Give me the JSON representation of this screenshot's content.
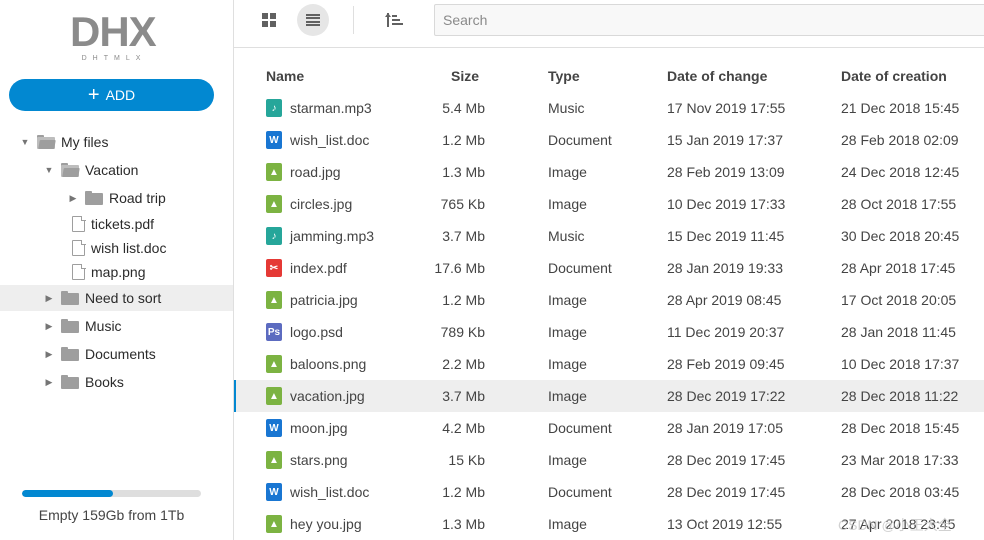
{
  "logo": {
    "text": "DHX",
    "subtext": "DHTMLX"
  },
  "add_button": {
    "label": "ADD",
    "icon": "plus-icon"
  },
  "tree": [
    {
      "label": "My files",
      "level": 0,
      "kind": "folder-open",
      "arrow": "down",
      "selected": false
    },
    {
      "label": "Vacation",
      "level": 1,
      "kind": "folder-open",
      "arrow": "down",
      "selected": false
    },
    {
      "label": "Road trip",
      "level": 2,
      "kind": "folder",
      "arrow": "right",
      "selected": false
    },
    {
      "label": "tickets.pdf",
      "level": 2,
      "kind": "file",
      "arrow": "",
      "selected": false
    },
    {
      "label": "wish list.doc",
      "level": 2,
      "kind": "file",
      "arrow": "",
      "selected": false
    },
    {
      "label": "map.png",
      "level": 2,
      "kind": "file",
      "arrow": "",
      "selected": false
    },
    {
      "label": "Need to sort",
      "level": 1,
      "kind": "folder",
      "arrow": "right",
      "selected": true
    },
    {
      "label": "Music",
      "level": 1,
      "kind": "folder",
      "arrow": "right",
      "selected": false
    },
    {
      "label": "Documents",
      "level": 1,
      "kind": "folder",
      "arrow": "right",
      "selected": false
    },
    {
      "label": "Books",
      "level": 1,
      "kind": "folder",
      "arrow": "right",
      "selected": false
    }
  ],
  "storage": {
    "text": "Empty 159Gb from 1Tb",
    "used_fraction": 0.51
  },
  "toolbar": {
    "grid_view_icon": "grid-view-icon",
    "list_view_icon": "list-view-icon",
    "active_view": "list",
    "sort_icon": "sort-icon",
    "search_placeholder": "Search",
    "search_value": ""
  },
  "table": {
    "columns": [
      "Name",
      "Size",
      "Type",
      "Date of change",
      "Date of creation"
    ],
    "rows": [
      {
        "icon": "music",
        "name": "starman.mp3",
        "size": "5.4 Mb",
        "type": "Music",
        "changed": "17 Nov 2019 17:55",
        "created": "21 Dec 2018 15:45"
      },
      {
        "icon": "doc",
        "name": "wish_list.doc",
        "size": "1.2 Mb",
        "type": "Document",
        "changed": "15 Jan 2019 17:37",
        "created": "28 Feb 2018 02:09"
      },
      {
        "icon": "image",
        "name": "road.jpg",
        "size": "1.3 Mb",
        "type": "Image",
        "changed": "28 Feb 2019 13:09",
        "created": "24 Dec 2018 12:45"
      },
      {
        "icon": "image",
        "name": "circles.jpg",
        "size": "765 Kb",
        "type": "Image",
        "changed": "10 Dec 2019 17:33",
        "created": "28 Oct 2018 17:55"
      },
      {
        "icon": "music",
        "name": "jamming.mp3",
        "size": "3.7 Mb",
        "type": "Music",
        "changed": "15 Dec 2019 11:45",
        "created": "30 Dec 2018 20:45"
      },
      {
        "icon": "pdf",
        "name": "index.pdf",
        "size": "17.6 Mb",
        "type": "Document",
        "changed": "28 Jan 2019 19:33",
        "created": "28 Apr 2018 17:45"
      },
      {
        "icon": "image",
        "name": "patricia.jpg",
        "size": "1.2 Mb",
        "type": "Image",
        "changed": "28 Apr 2019 08:45",
        "created": "17 Oct 2018 20:05"
      },
      {
        "icon": "psd",
        "name": "logo.psd",
        "size": "789 Kb",
        "type": "Image",
        "changed": "11 Dec 2019 20:37",
        "created": "28 Jan 2018 11:45"
      },
      {
        "icon": "image",
        "name": "baloons.png",
        "size": "2.2 Mb",
        "type": "Image",
        "changed": "28 Feb 2019 09:45",
        "created": "10 Dec 2018 17:37"
      },
      {
        "icon": "image",
        "name": "vacation.jpg",
        "size": "3.7 Mb",
        "type": "Image",
        "changed": "28 Dec 2019 17:22",
        "created": "28 Dec 2018 11:22",
        "selected": true
      },
      {
        "icon": "doc",
        "name": "moon.jpg",
        "size": "4.2 Mb",
        "type": "Document",
        "changed": "28 Jan 2019 17:05",
        "created": "28 Dec 2018 15:45"
      },
      {
        "icon": "image",
        "name": "stars.png",
        "size": "15 Kb",
        "type": "Image",
        "changed": "28 Dec 2019 17:45",
        "created": "23 Mar 2018 17:33"
      },
      {
        "icon": "doc",
        "name": "wish_list.doc",
        "size": "1.2 Mb",
        "type": "Document",
        "changed": "28 Dec 2019 17:45",
        "created": "28 Dec 2018 03:45"
      },
      {
        "icon": "image",
        "name": "hey you.jpg",
        "size": "1.3 Mb",
        "type": "Image",
        "changed": "13 Oct 2019 12:55",
        "created": "27 Apr 2018 23:45"
      }
    ]
  },
  "watermark": "CSDN @小王大全",
  "colors": {
    "accent": "#0288d1",
    "music": "#26a69a",
    "doc": "#1976d2",
    "image": "#7cb342",
    "pdf": "#e53935",
    "psd": "#5c6bc0"
  }
}
